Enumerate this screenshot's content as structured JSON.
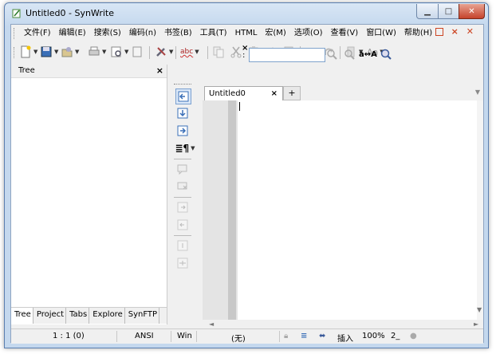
{
  "window": {
    "title": "Untitled0 - SynWrite",
    "min_label": "▁",
    "max_label": "□",
    "close_label": "✕"
  },
  "menubar": {
    "items": [
      {
        "label": "文件(F)"
      },
      {
        "label": "编辑(E)"
      },
      {
        "label": "搜索(S)"
      },
      {
        "label": "编码(n)"
      },
      {
        "label": "书签(B)"
      },
      {
        "label": "工具(T)"
      },
      {
        "label": "HTML"
      },
      {
        "label": "宏(M)"
      },
      {
        "label": "选项(O)"
      },
      {
        "label": "查看(V)"
      },
      {
        "label": "窗口(W)"
      },
      {
        "label": "帮助(H)"
      }
    ]
  },
  "toolbar": {
    "icons": [
      "new-file-icon",
      "save-icon",
      "open-icon",
      "print-icon",
      "print-preview-icon",
      "doc-icon",
      "tools-icon",
      "spellcheck-icon",
      "copy-icon",
      "cut-icon",
      "paste-icon",
      "clear-icon",
      "file-icon",
      "undo-icon",
      "redo-icon",
      "bookmark-icon",
      "font-icon"
    ],
    "spellcheck_label": "abc",
    "font_label": "Aa",
    "case_label": "a↔A",
    "search_placeholder": ""
  },
  "tree": {
    "title": "Tree",
    "close": "×",
    "tabs": [
      "Tree",
      "Project",
      "Tabs",
      "Explore",
      "SynFTP"
    ]
  },
  "editor": {
    "tab_label": "Untitled0",
    "tab_close": "×",
    "add_tab": "+"
  },
  "status": {
    "position": "1 : 1 (0)",
    "encoding": "ANSI",
    "line_ending": "Win",
    "syntax": "(无)",
    "insert_mode": "插入",
    "zoom": "100%",
    "extra": "2_"
  },
  "colors": {
    "accent": "#3a6fb7",
    "title_bg": "#c4d8ee",
    "close_red": "#c6432b"
  }
}
